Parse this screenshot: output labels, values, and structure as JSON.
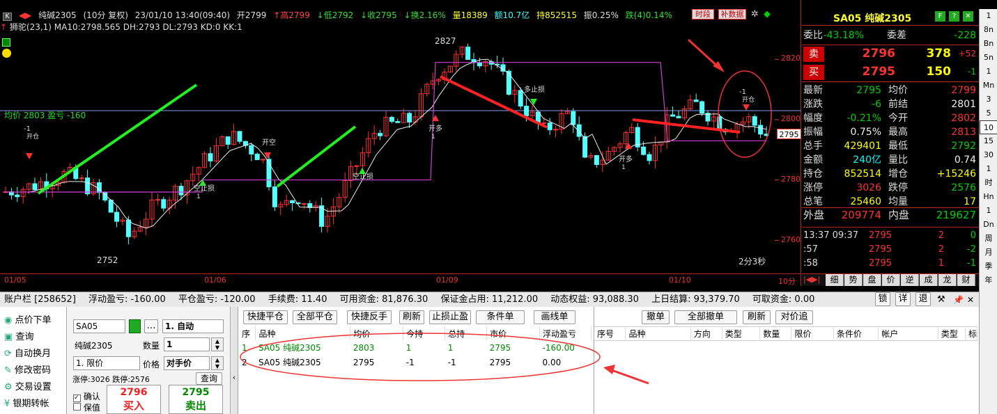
{
  "header": {
    "symbol": "纯碱2305",
    "period": "(10分 复权)",
    "datetime": "23/01/10 13:40(09:40)",
    "open": "开2799",
    "high": "↑高2799",
    "low": "↓低2792",
    "close": "↓收2795",
    "turnover": "↓换2.16%",
    "volume": "量18389",
    "amount": "额10.7亿",
    "position": "持852515",
    "amplitude": "振0.25%",
    "change": "跌(4)0.14%",
    "indicator_line": "狮驼(23,1) MA10:2798.565 DH:2793 DL:2793 KD:0 KK:1",
    "btn_period": "时段",
    "btn_fill": "补数据"
  },
  "chart": {
    "avg_label": "均价 2803 盈亏 -160",
    "hi_label": "2827",
    "lo_label": "2752",
    "price_ticks": [
      "2820",
      "2800",
      "2780",
      "2760"
    ],
    "date_ticks": [
      "01/05",
      "01/06",
      "01/09",
      "01/10"
    ],
    "cur_price_tag": "2795",
    "countdown": "2分3秒",
    "period_tag": "10分",
    "annotations": [
      {
        "text": "-1",
        "sub": "开仓"
      },
      {
        "text": "开空",
        "sub": ""
      },
      {
        "text": "空止损",
        "sub": "1"
      },
      {
        "text": "开多",
        "sub": "1"
      },
      {
        "text": "多止损",
        "sub": ""
      },
      {
        "text": "开多",
        "sub": "1"
      },
      {
        "text": "-1",
        "sub": "开仓"
      },
      {
        "text": "空止损",
        "sub": ""
      }
    ],
    "chart_data": {
      "type": "candlestick",
      "ylim": [
        2752,
        2827
      ],
      "ma_label": "MA10",
      "avg_price": 2803
    }
  },
  "quote": {
    "title": "SA05 纯碱2305",
    "weibi_label": "委比",
    "weibi": "-43.18%",
    "weicha_label": "委差",
    "weicha": "-228",
    "sell_label": "卖",
    "sell_price": "2796",
    "sell_vol": "378",
    "sell_chg": "+52",
    "buy_label": "买",
    "buy_price": "2795",
    "buy_vol": "150",
    "buy_chg": "-1",
    "rows": [
      {
        "l1": "最新",
        "v1": "2795",
        "c1": "grn",
        "l2": "均价",
        "v2": "2799",
        "c2": "red"
      },
      {
        "l1": "涨跌",
        "v1": "-6",
        "c1": "grn",
        "l2": "前结",
        "v2": "2801",
        "c2": "wht"
      },
      {
        "l1": "幅度",
        "v1": "-0.21%",
        "c1": "grn",
        "l2": "今开",
        "v2": "2802",
        "c2": "red"
      },
      {
        "l1": "振幅",
        "v1": "0.75%",
        "c1": "wht",
        "l2": "最高",
        "v2": "2813",
        "c2": "red"
      },
      {
        "l1": "总手",
        "v1": "429401",
        "c1": "yel",
        "l2": "最低",
        "v2": "2792",
        "c2": "grn"
      },
      {
        "l1": "金额",
        "v1": "240亿",
        "c1": "cyan",
        "l2": "量比",
        "v2": "0.74",
        "c2": "wht"
      },
      {
        "l1": "持仓",
        "v1": "852514",
        "c1": "yel",
        "l2": "增仓",
        "v2": "+15246",
        "c2": "yel"
      },
      {
        "l1": "涨停",
        "v1": "3026",
        "c1": "red",
        "l2": "跌停",
        "v2": "2576",
        "c2": "grn"
      },
      {
        "l1": "总笔",
        "v1": "25460",
        "c1": "yel",
        "l2": "均量",
        "v2": "17",
        "c2": "yel"
      }
    ],
    "outer_label": "外盘",
    "outer": "209774",
    "inner_label": "内盘",
    "inner": "219627",
    "ticks": [
      {
        "t": "13:37 09:37",
        "p": "2795",
        "v": "2",
        "c": "0"
      },
      {
        "t": ":57",
        "p": "2795",
        "v": "2",
        "c": "-2"
      },
      {
        "t": ":58",
        "p": "2795",
        "v": "1",
        "c": "-1"
      }
    ],
    "tabs": [
      "细",
      "势",
      "盘",
      "价",
      "逆",
      "成",
      "龙",
      "财"
    ]
  },
  "toolbar_right": [
    "1",
    "8n",
    "Bn",
    "5n",
    "1",
    "Mn",
    "3",
    "5",
    "10",
    "15",
    "30",
    "1",
    "时",
    "Hn",
    "1",
    "Dn",
    "周",
    "月",
    "季",
    "年"
  ],
  "account": {
    "bar": "账户栏 [258652]",
    "float_pl": "浮动盈亏: -160.00",
    "close_pl": "平仓盈亏: -120.00",
    "fee": "手续费: 11.40",
    "avail": "可用资金: 81,876.30",
    "margin": "保证金占用: 11,212.00",
    "equity": "动态权益: 93,088.30",
    "prev_settle": "上日结算: 93,379.70",
    "withdraw": "可取资金: 0.00",
    "btn_lock": "锁",
    "btn_detail": "详",
    "btn_exit": "退"
  },
  "nav": [
    "点价下单",
    "查询",
    "自动换月",
    "修改密码",
    "交易设置",
    "银期转帐"
  ],
  "order": {
    "code": "SA05",
    "name": "纯碱2305",
    "mode": "1. 自动",
    "qty_label": "数量",
    "qty": "1",
    "price_type": "1. 限价",
    "price_label": "价格",
    "price": "对手价",
    "limits": "涨停:3026 跌停:2576",
    "query_btn": "查询",
    "confirm": "确认",
    "keep": "保值",
    "buy_price": "2796",
    "buy_text": "买入",
    "sell_price": "2795",
    "sell_text": "卖出"
  },
  "pos_buttons": [
    "快捷平仓",
    "全部平仓",
    "快捷反手",
    "刷新",
    "止损止盈",
    "条件单",
    "画线单"
  ],
  "pos_headers": [
    "序",
    "品种",
    "均价",
    "今持",
    "总持",
    "市价",
    "浮动盈亏"
  ],
  "positions": [
    [
      "1",
      "SA05 纯碱2305",
      "2803",
      "1",
      "1",
      "2795",
      "-160.00"
    ],
    [
      "2",
      "SA05 纯碱2305",
      "2795",
      "-1",
      "-1",
      "2795",
      "0.00"
    ]
  ],
  "ord_buttons": [
    "撤单",
    "全部撤单",
    "刷新",
    "对价追"
  ],
  "ord_headers": [
    "序号",
    "品种",
    "方向",
    "类型",
    "数量",
    "限价",
    "条件价",
    "帐户",
    "类型",
    "标"
  ]
}
